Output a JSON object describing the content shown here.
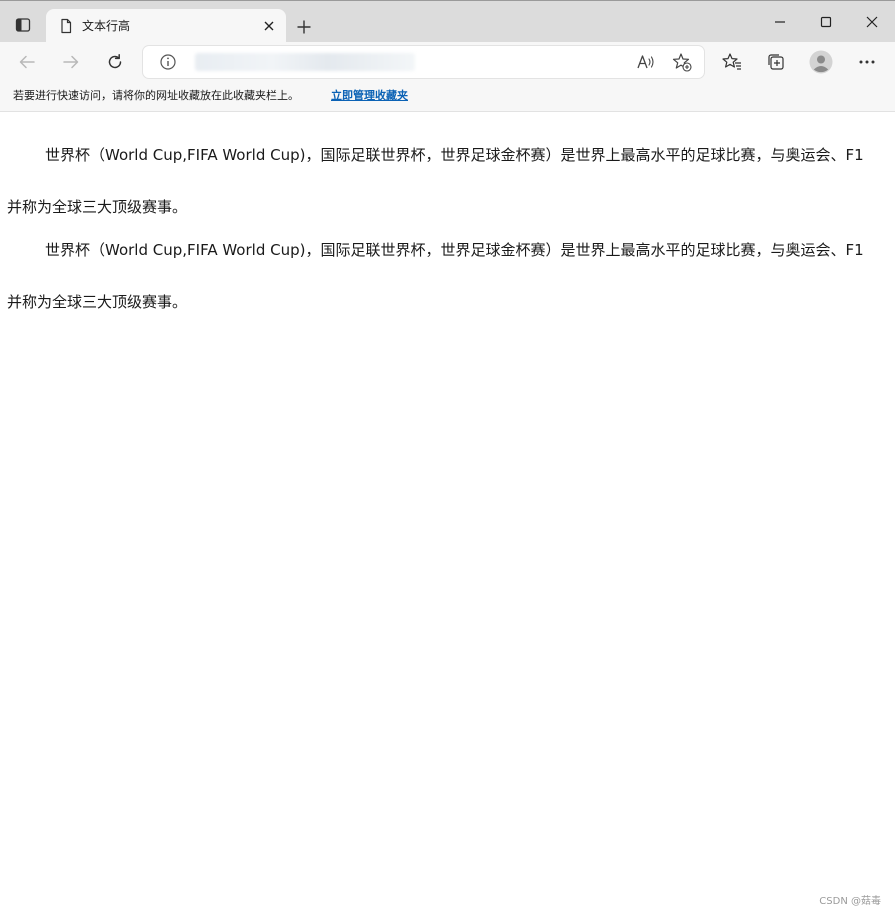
{
  "tab": {
    "title": "文本行高"
  },
  "favorites_bar": {
    "prompt_text": "若要进行快速访问，请将你的网址收藏放在此收藏夹栏上。",
    "manage_link": "立即管理收藏夹"
  },
  "content": {
    "paragraphs": [
      "世界杯（World Cup,FIFA World Cup)，国际足联世界杯，世界足球金杯赛）是世界上最高水平的足球比赛，与奥运会、F1并称为全球三大顶级赛事。",
      "世界杯（World Cup,FIFA World Cup)，国际足联世界杯，世界足球金杯赛）是世界上最高水平的足球比赛，与奥运会、F1并称为全球三大顶级赛事。"
    ]
  },
  "watermark": "CSDN @菇毒",
  "colors": {
    "tabstrip": "#dcdcdc",
    "toolbar": "#f7f7f7",
    "link": "#0b62b5",
    "icon": "#333333"
  },
  "icons": {
    "tab_actions": "tab-actions-icon",
    "page": "page-icon",
    "close": "close-icon",
    "new_tab": "plus-icon",
    "back": "arrow-left-icon",
    "forward": "arrow-right-icon",
    "refresh": "refresh-icon",
    "info": "info-icon",
    "read_aloud": "read-aloud-icon",
    "add_favorite": "star-plus-icon",
    "favorites": "favorites-icon",
    "collections": "collections-icon",
    "profile": "avatar-icon",
    "more": "ellipsis-icon"
  }
}
